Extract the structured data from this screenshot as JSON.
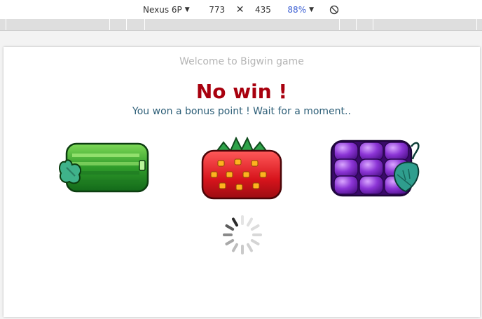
{
  "toolbar": {
    "device": "Nexus 6P",
    "width": "773",
    "height": "435",
    "zoom": "88%",
    "rotate_icon": "rotate-icon"
  },
  "game": {
    "welcome": "Welcome to Bigwin game",
    "result": "No win !",
    "bonus_message": "You won a bonus point ! Wait for a moment..",
    "reels": [
      {
        "symbol": "watermelon-icon"
      },
      {
        "symbol": "strawberry-icon"
      },
      {
        "symbol": "grapes-icon"
      }
    ],
    "loading_icon": "loading-spinner-icon"
  },
  "colors": {
    "result": "#a8000e",
    "bonus": "#2e5f78",
    "welcome": "#b5b5b5",
    "zoom": "#3f62d4"
  }
}
